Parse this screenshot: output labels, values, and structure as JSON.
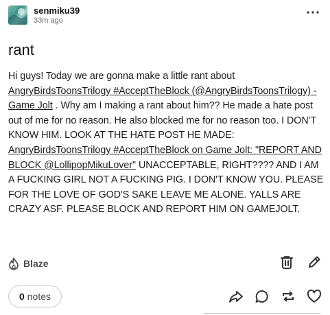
{
  "post": {
    "username": "senmiku39",
    "time": "33m ago",
    "title": "rant",
    "body": [
      {
        "text": "Hi guys! Today we are gonna make a little rant about "
      },
      {
        "text": "AngryBirdsToonsTrilogy #AcceptTheBlock (@AngryBirdsToonsTrilogy) - Game Jolt",
        "link": true
      },
      {
        "text": " . Why am I making a rant about him?? He made a hate post out of me for no reason. He also blocked me for no reason too. I DON'T KNOW HIM. LOOK AT THE HATE POST HE MADE: "
      },
      {
        "text": "AngryBirdsToonsTrilogy #AcceptTheBlock on Game Jolt: \"REPORT AND BLOCK @LollipopMikuLover\"",
        "link": true
      },
      {
        "text": " UNACCEPTABLE, RIGHT???? AND I AM A FUCKING GIRL NOT A FUCKING PIG. I DON'T KNOW YOU. PLEASE FOR THE LOVE OF GOD'S SAKE LEAVE ME ALONE. YALLS ARE CRAZY ASF. PLEASE BLOCK AND REPORT HIM ON GAMEJOLT."
      }
    ]
  },
  "footer": {
    "blaze_label": "Blaze",
    "notes_count": "0",
    "notes_label": "notes"
  },
  "icons": {
    "more": "more-options-icon",
    "blaze": "flame-icon",
    "delete": "trash-icon",
    "edit": "pencil-icon",
    "share": "share-icon",
    "reply": "comment-icon",
    "reblog": "reblog-icon",
    "like": "heart-icon"
  },
  "colors": {
    "text": "#121212",
    "muted": "#6b6b6b",
    "border": "#c9c9c9"
  }
}
